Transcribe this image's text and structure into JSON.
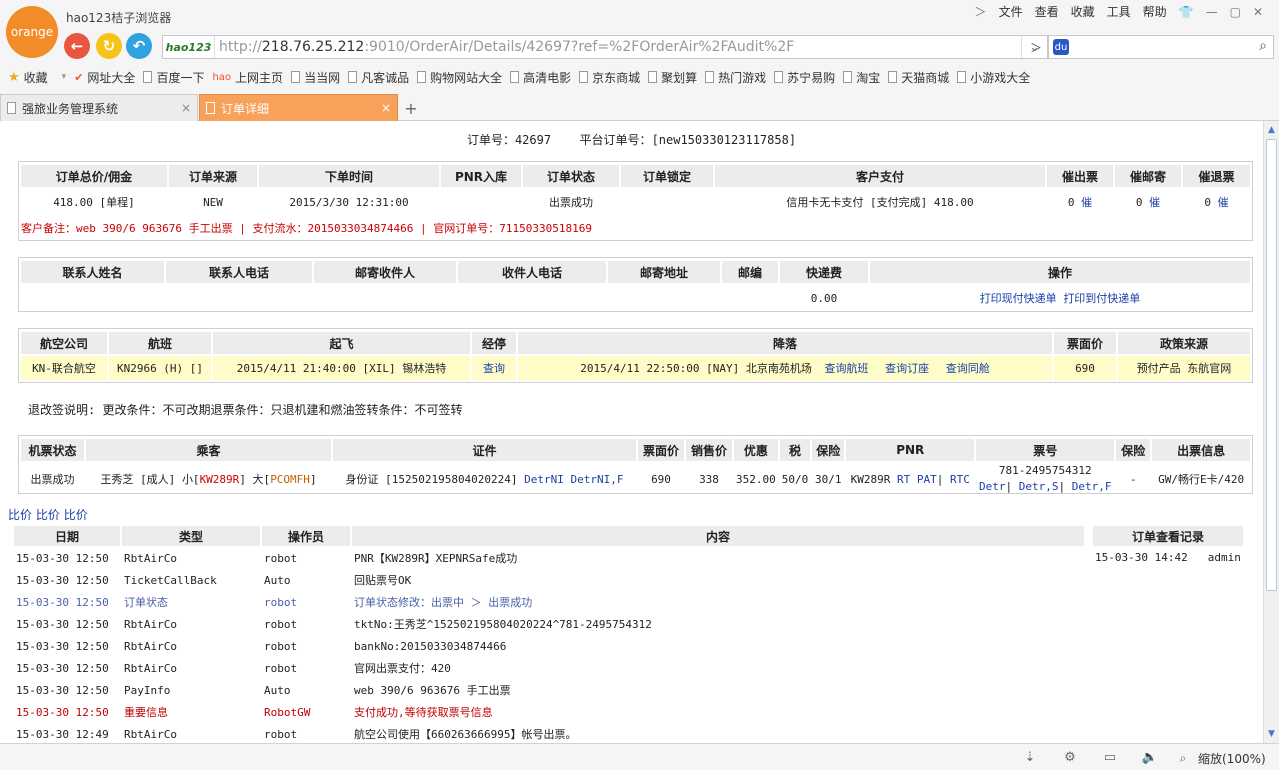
{
  "browser": {
    "logo_text": "orange",
    "title": "hao123桔子浏览器",
    "menu": [
      "文件",
      "查看",
      "收藏",
      "工具",
      "帮助"
    ],
    "address_badge": "hao123",
    "url_prefix": "http://",
    "url_host": "218.76.25.212",
    "url_rest": ":9010/OrderAir/Details/42697?ref=%2FOrderAir%2FAudit%2F",
    "bookmarks": [
      "收藏",
      "网址大全",
      "百度一下",
      "上网主页",
      "当当网",
      "凡客诚品",
      "购物网站大全",
      "高清电影",
      "京东商城",
      "聚划算",
      "热门游戏",
      "苏宁易购",
      "淘宝",
      "天猫商城",
      "小游戏大全"
    ],
    "tabs": [
      "强旅业务管理系统",
      "订单详细"
    ],
    "zoom": "缩放(100%)"
  },
  "order": {
    "order_no_label": "订单号：",
    "order_no": "42697",
    "platform_no_label": "平台订单号：",
    "platform_no": "[new150330123117858]"
  },
  "summary": {
    "headers": [
      "订单总价/佣金",
      "订单来源",
      "下单时间",
      "PNR入库",
      "订单状态",
      "订单锁定",
      "客户支付",
      "催出票",
      "催邮寄",
      "催退票"
    ],
    "row": [
      "418.00 [单程]",
      "NEW",
      "2015/3/30 12:31:00",
      "",
      "出票成功",
      "",
      "信用卡无卡支付 [支付完成] 418.00"
    ],
    "urge_counts": [
      "0",
      "0",
      "0"
    ],
    "urge_link": "催",
    "remark": "客户备注：web 390/6 963676 手工出票 | 支付流水：2015033034874466 | 官网订单号：71150330518169"
  },
  "contact": {
    "headers": [
      "联系人姓名",
      "联系人电话",
      "邮寄收件人",
      "收件人电话",
      "邮寄地址",
      "邮编",
      "快递费",
      "操作"
    ],
    "express_fee": "0.00",
    "actions": [
      "打印现付快递单",
      "打印到付快递单"
    ]
  },
  "flight": {
    "headers": [
      "航空公司",
      "航班",
      "起飞",
      "经停",
      "降落",
      "票面价",
      "政策来源"
    ],
    "airline": "KN-联合航空",
    "flight_no": "KN2966 (H) []",
    "depart": "2015/4/11 21:40:00 [XIL] 锡林浩特",
    "stop_link": "查询",
    "arrive": "2015/4/11 22:50:00 [NAY] 北京南苑机场",
    "arrive_links": [
      "查询航班",
      "查询订座",
      "查询同舱"
    ],
    "price": "690",
    "policy": "预付产品 东航官网"
  },
  "rules": "退改签说明: 更改条件：不可改期退票条件：只退机建和燃油签转条件：不可签转",
  "passenger": {
    "headers": [
      "机票状态",
      "乘客",
      "证件",
      "票面价",
      "销售价",
      "优惠",
      "税",
      "保险",
      "PNR",
      "票号",
      "保险",
      "出票信息"
    ],
    "status": "出票成功",
    "name": "王秀芝",
    "type": "[成人]",
    "small_label": "小[",
    "small_pnr": "KW289R",
    "big_label": "] 大[",
    "big_pnr": "PCOMFH",
    "close": "]",
    "id_text": "身份证 [152502195804020224]",
    "id_links": [
      "DetrNI",
      "DetrNI,F"
    ],
    "face_price": "690",
    "sale_price": "338",
    "discount": "352.00",
    "tax": "50/0",
    "insurance": "30/1",
    "pnr": "KW289R",
    "pnr_links": [
      "RT",
      "PAT",
      "RTC"
    ],
    "ticket_no": "781-2495754312",
    "ticket_links": [
      "Detr",
      "Detr,S",
      "Detr,F"
    ],
    "insurance2": "-",
    "issue_info": "GW/畅行E卡/420"
  },
  "compare_links": [
    "比价",
    "比价",
    "比价"
  ],
  "log": {
    "headers": [
      "日期",
      "类型",
      "操作员",
      "内容"
    ],
    "rows": [
      {
        "date": "15-03-30 12:50",
        "type": "RbtAirCo",
        "op": "robot",
        "content": "PNR【KW289R】XEPNRSafe成功",
        "style": "normal"
      },
      {
        "date": "15-03-30 12:50",
        "type": "TicketCallBack",
        "op": "Auto",
        "content": "回贴票号OK",
        "style": "normal"
      },
      {
        "date": "15-03-30 12:50",
        "type": "订单状态",
        "op": "robot",
        "content": "订单状态修改：出票中 ＞ 出票成功",
        "style": "status"
      },
      {
        "date": "15-03-30 12:50",
        "type": "RbtAirCo",
        "op": "robot",
        "content": "tktNo:王秀芝^152502195804020224^781-2495754312",
        "style": "normal"
      },
      {
        "date": "15-03-30 12:50",
        "type": "RbtAirCo",
        "op": "robot",
        "content": "bankNo:2015033034874466",
        "style": "normal"
      },
      {
        "date": "15-03-30 12:50",
        "type": "RbtAirCo",
        "op": "robot",
        "content": "官网出票支付：420",
        "style": "normal"
      },
      {
        "date": "15-03-30 12:50",
        "type": "PayInfo",
        "op": "Auto",
        "content": "web 390/6 963676 手工出票",
        "style": "normal"
      },
      {
        "date": "15-03-30 12:50",
        "type": "重要信息",
        "op": "RobotGW",
        "content": "支付成功,等待获取票号信息",
        "style": "important"
      },
      {
        "date": "15-03-30 12:49",
        "type": "RbtAirCo",
        "op": "robot",
        "content": "航空公司使用【660263666995】帐号出票。",
        "style": "normal"
      }
    ]
  },
  "view_log": {
    "header": "订单查看记录",
    "rows": [
      {
        "time": "15-03-30 14:42",
        "user": "admin"
      }
    ]
  },
  "colors": {
    "tab_active": "#f7a15a",
    "link": "#1a3ea8",
    "highlight_row": "#fffdc7",
    "important": "#c00000",
    "status_row": "#4a5fa8"
  }
}
